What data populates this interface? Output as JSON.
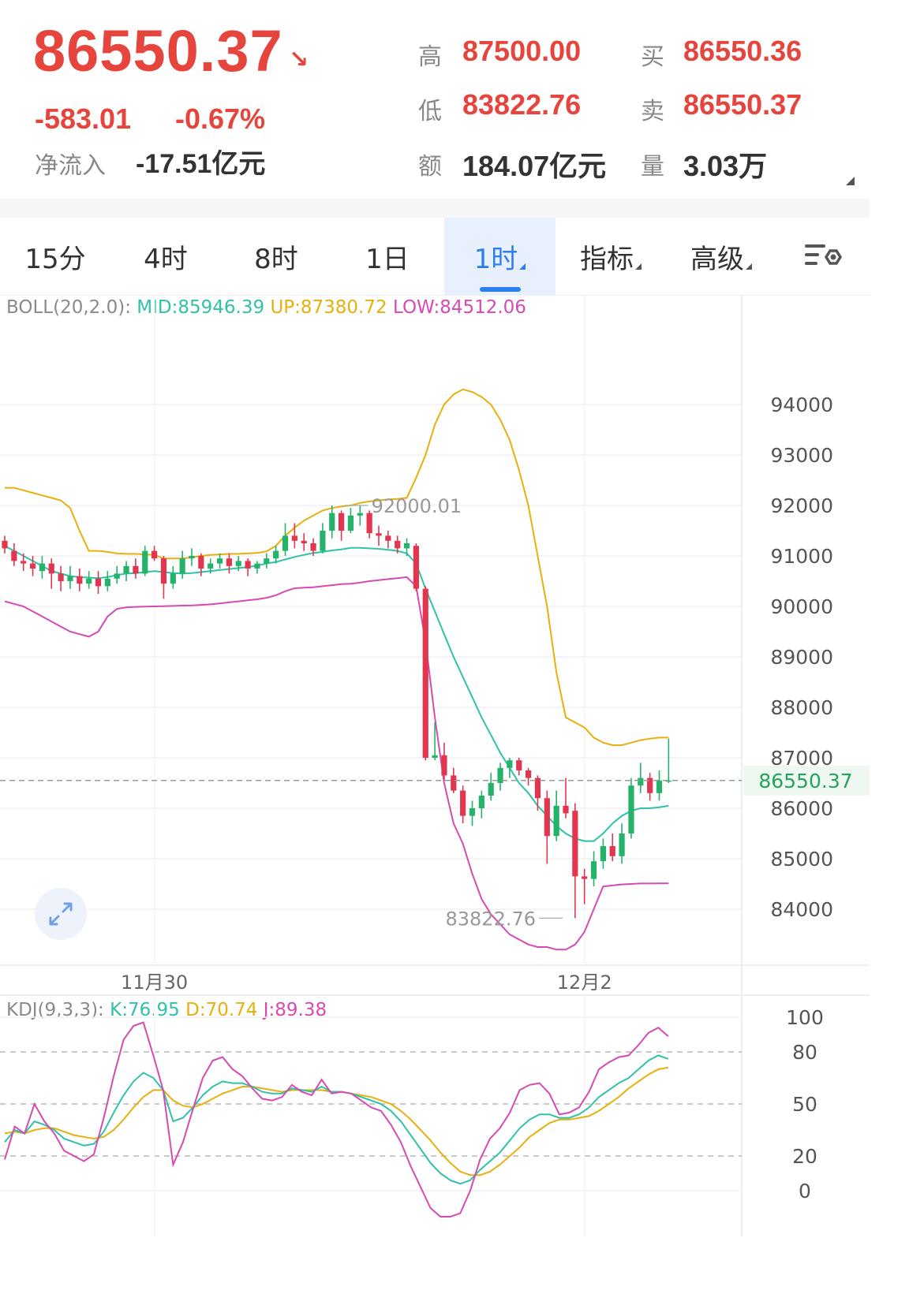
{
  "quote": {
    "price": "86550.37",
    "arrow": "↘",
    "change": "-583.01",
    "change_pct": "-0.67%",
    "netflow_label": "净流入",
    "netflow_value": "-17.51亿元",
    "high_label": "高",
    "high_value": "87500.00",
    "low_label": "低",
    "low_value": "83822.76",
    "amount_label": "额",
    "amount_value": "184.07亿元",
    "bid_label": "买",
    "bid_value": "86550.36",
    "ask_label": "卖",
    "ask_value": "86550.37",
    "volume_label": "量",
    "volume_value": "3.03万"
  },
  "tabs": [
    {
      "label": "15分",
      "active": false,
      "dropdown": false
    },
    {
      "label": "4时",
      "active": false,
      "dropdown": false
    },
    {
      "label": "8时",
      "active": false,
      "dropdown": false
    },
    {
      "label": "1日",
      "active": false,
      "dropdown": false
    },
    {
      "label": "1时",
      "active": true,
      "dropdown": true
    },
    {
      "label": "指标",
      "active": false,
      "dropdown": true
    },
    {
      "label": "高级",
      "active": false,
      "dropdown": true
    }
  ],
  "settings_icon": "chart-settings-icon",
  "expand_icon": "expand-arrows-icon",
  "colors": {
    "up": "#25b36a",
    "down": "#e2364f",
    "mid": "#2fc2a8",
    "upper": "#e8b00d",
    "lower": "#d64ab4",
    "accent": "#2d7ff0"
  },
  "chart_data": [
    {
      "type": "candlestick",
      "indicator": {
        "name": "BOLL(20,2.0):",
        "mid_label": "MID:85946.39",
        "up_label": "UP:87380.72",
        "low_label": "LOW:84512.06"
      },
      "y_ticks": [
        94000,
        93000,
        92000,
        91000,
        90000,
        89000,
        88000,
        87000,
        86000,
        85000,
        84000
      ],
      "ylim": [
        83300,
        94800
      ],
      "x_labels": [
        {
          "label": "11月30",
          "index": 16
        },
        {
          "label": "12月2",
          "index": 62
        }
      ],
      "last_price_label": "86550.37",
      "max_annotation": {
        "label": "92000.01",
        "index": 36,
        "value": 92000.01
      },
      "min_annotation": {
        "label": "83822.76",
        "index": 60,
        "value": 83822.76
      },
      "candles": [
        [
          91300,
          91150,
          91400,
          91050
        ],
        [
          91100,
          90900,
          91250,
          90800
        ],
        [
          90900,
          90850,
          91050,
          90700
        ],
        [
          90850,
          90750,
          91000,
          90600
        ],
        [
          90700,
          90850,
          91000,
          90550
        ],
        [
          90850,
          90650,
          90950,
          90350
        ],
        [
          90650,
          90500,
          90800,
          90300
        ],
        [
          90500,
          90600,
          90800,
          90350
        ],
        [
          90600,
          90450,
          90750,
          90300
        ],
        [
          90450,
          90550,
          90700,
          90350
        ],
        [
          90550,
          90400,
          90700,
          90250
        ],
        [
          90400,
          90550,
          90700,
          90300
        ],
        [
          90550,
          90650,
          90800,
          90450
        ],
        [
          90650,
          90800,
          90900,
          90500
        ],
        [
          90800,
          90650,
          90950,
          90550
        ],
        [
          90650,
          91100,
          91200,
          90600
        ],
        [
          91100,
          90950,
          91200,
          90900
        ],
        [
          90950,
          90450,
          91000,
          90150
        ],
        [
          90450,
          90650,
          90800,
          90350
        ],
        [
          90650,
          90950,
          91100,
          90550
        ],
        [
          90950,
          91000,
          91150,
          90800
        ],
        [
          91000,
          90750,
          91050,
          90600
        ],
        [
          90750,
          90850,
          90950,
          90650
        ],
        [
          90850,
          90950,
          91050,
          90750
        ],
        [
          90950,
          90800,
          91050,
          90650
        ],
        [
          90800,
          90900,
          91000,
          90700
        ],
        [
          90900,
          90750,
          90950,
          90600
        ],
        [
          90750,
          90850,
          90900,
          90650
        ],
        [
          90850,
          90950,
          91050,
          90750
        ],
        [
          90950,
          91100,
          91200,
          90850
        ],
        [
          91100,
          91400,
          91650,
          91000
        ],
        [
          91400,
          91300,
          91650,
          91150
        ],
        [
          91300,
          91250,
          91450,
          91100
        ],
        [
          91250,
          91100,
          91350,
          91000
        ],
        [
          91100,
          91500,
          91650,
          91050
        ],
        [
          91500,
          91850,
          92000,
          91350
        ],
        [
          91850,
          91500,
          91900,
          91300
        ],
        [
          91500,
          91800,
          91950,
          91450
        ],
        [
          91800,
          91850,
          92000,
          91600
        ],
        [
          91850,
          91450,
          91900,
          91350
        ],
        [
          91450,
          91400,
          91600,
          91200
        ],
        [
          91400,
          91300,
          91500,
          91150
        ],
        [
          91300,
          91150,
          91400,
          91050
        ],
        [
          91150,
          91250,
          91350,
          91000
        ],
        [
          91200,
          90350,
          91250,
          90300
        ],
        [
          90350,
          87000,
          90400,
          86950
        ],
        [
          87000,
          87050,
          87700,
          86950
        ],
        [
          87050,
          86650,
          87300,
          86550
        ],
        [
          86650,
          86350,
          86800,
          86300
        ],
        [
          86350,
          85850,
          86450,
          85700
        ],
        [
          85850,
          86000,
          86150,
          85650
        ],
        [
          86000,
          86250,
          86350,
          85800
        ],
        [
          86250,
          86500,
          86700,
          86150
        ],
        [
          86500,
          86800,
          86900,
          86350
        ],
        [
          86800,
          86950,
          87000,
          86600
        ],
        [
          86950,
          86750,
          87000,
          86650
        ],
        [
          86750,
          86600,
          86800,
          86450
        ],
        [
          86600,
          86200,
          86650,
          85950
        ],
        [
          86200,
          85450,
          86350,
          84900
        ],
        [
          85450,
          86050,
          86350,
          85350
        ],
        [
          86050,
          85900,
          86600,
          85800
        ],
        [
          85950,
          84650,
          86100,
          83822.76
        ],
        [
          84650,
          84600,
          84800,
          84100
        ],
        [
          84600,
          84950,
          85150,
          84450
        ],
        [
          84950,
          85250,
          85400,
          84800
        ],
        [
          85250,
          85050,
          85500,
          84950
        ],
        [
          85050,
          85500,
          85700,
          84900
        ],
        [
          85500,
          86450,
          86600,
          85400
        ],
        [
          86450,
          86600,
          86900,
          86300
        ],
        [
          86600,
          86300,
          86700,
          86150
        ],
        [
          86300,
          86550,
          86750,
          86150
        ],
        [
          86550,
          86550,
          87380,
          86500
        ]
      ],
      "boll_mid": [
        91200,
        91100,
        91000,
        90900,
        90800,
        90700,
        90650,
        90600,
        90580,
        90570,
        90560,
        90580,
        90620,
        90650,
        90660,
        90680,
        90700,
        90680,
        90660,
        90650,
        90660,
        90680,
        90700,
        90720,
        90740,
        90760,
        90780,
        90810,
        90850,
        90880,
        90930,
        90980,
        91020,
        91060,
        91080,
        91110,
        91130,
        91160,
        91160,
        91150,
        91140,
        91120,
        91100,
        91050,
        90850,
        90350,
        89900,
        89450,
        89000,
        88600,
        88200,
        87800,
        87450,
        87100,
        86800,
        86500,
        86300,
        86050,
        85850,
        85650,
        85500,
        85400,
        85350,
        85350,
        85500,
        85700,
        85850,
        85950,
        86000,
        86000,
        86020,
        86050
      ],
      "boll_up": [
        92350,
        92350,
        92300,
        92250,
        92200,
        92150,
        92100,
        91950,
        91500,
        91100,
        91100,
        91080,
        91050,
        91040,
        91040,
        91030,
        91020,
        90950,
        90950,
        90950,
        90970,
        91000,
        91020,
        91030,
        91040,
        91040,
        91050,
        91060,
        91090,
        91200,
        91400,
        91560,
        91700,
        91800,
        91900,
        91950,
        91980,
        92000,
        92050,
        92080,
        92100,
        92120,
        92130,
        92150,
        92550,
        93000,
        93600,
        94000,
        94200,
        94300,
        94250,
        94150,
        94000,
        93700,
        93300,
        92700,
        92000,
        91000,
        90000,
        88700,
        87800,
        87700,
        87600,
        87400,
        87300,
        87250,
        87250,
        87300,
        87350,
        87380,
        87400,
        87400
      ],
      "boll_low": [
        90100,
        90050,
        90000,
        89900,
        89800,
        89700,
        89600,
        89500,
        89450,
        89400,
        89500,
        89800,
        89950,
        89980,
        89990,
        89995,
        90000,
        90005,
        90010,
        90015,
        90020,
        90030,
        90040,
        90060,
        90080,
        90100,
        90120,
        90140,
        90170,
        90220,
        90300,
        90360,
        90370,
        90380,
        90400,
        90420,
        90440,
        90450,
        90470,
        90500,
        90520,
        90540,
        90560,
        90580,
        90400,
        89300,
        87800,
        86500,
        85700,
        85300,
        84700,
        84200,
        83900,
        83700,
        83500,
        83400,
        83300,
        83250,
        83250,
        83200,
        83200,
        83300,
        83550,
        84000,
        84450,
        84470,
        84490,
        84500,
        84510,
        84510,
        84512,
        84512
      ]
    },
    {
      "type": "line",
      "indicator": {
        "name": "KDJ(9,3,3):",
        "k_label": "K:76.95",
        "d_label": "D:70.74",
        "j_label": "J:89.38"
      },
      "y_ticks": [
        100,
        80,
        50,
        20,
        0
      ],
      "ylim": [
        -5,
        105
      ],
      "reference_lines": [
        80,
        50,
        20
      ],
      "k": [
        28,
        35,
        33,
        40,
        38,
        35,
        30,
        28,
        26,
        27,
        34,
        45,
        55,
        63,
        68,
        65,
        58,
        40,
        42,
        48,
        55,
        60,
        63,
        62,
        62,
        60,
        57,
        56,
        56,
        59,
        58,
        57,
        60,
        57,
        57,
        56,
        54,
        52,
        50,
        46,
        40,
        32,
        24,
        16,
        10,
        6,
        4,
        6,
        12,
        17,
        22,
        29,
        36,
        41,
        44,
        44,
        42,
        42,
        44,
        48,
        54,
        58,
        62,
        65,
        70,
        75,
        78,
        76
      ],
      "d": [
        33,
        34,
        33,
        35,
        36,
        36,
        34,
        32,
        31,
        30,
        31,
        35,
        41,
        48,
        54,
        58,
        58,
        52,
        49,
        48,
        50,
        53,
        56,
        58,
        60,
        60,
        59,
        58,
        57,
        58,
        58,
        58,
        58,
        57,
        57,
        56,
        55,
        54,
        52,
        50,
        46,
        41,
        35,
        29,
        22,
        16,
        11,
        9,
        9,
        11,
        15,
        20,
        25,
        31,
        35,
        39,
        41,
        41,
        42,
        43,
        46,
        50,
        54,
        59,
        63,
        67,
        70,
        71
      ],
      "j": [
        18,
        37,
        33,
        50,
        40,
        33,
        23,
        20,
        17,
        21,
        42,
        66,
        87,
        95,
        97,
        78,
        58,
        15,
        28,
        47,
        65,
        75,
        77,
        70,
        66,
        59,
        53,
        52,
        54,
        61,
        57,
        55,
        64,
        56,
        57,
        56,
        52,
        48,
        46,
        38,
        28,
        14,
        2,
        -10,
        -15,
        -15,
        -13,
        0,
        18,
        30,
        36,
        45,
        58,
        61,
        62,
        56,
        44,
        45,
        48,
        57,
        70,
        74,
        77,
        78,
        84,
        91,
        94,
        89
      ]
    }
  ]
}
